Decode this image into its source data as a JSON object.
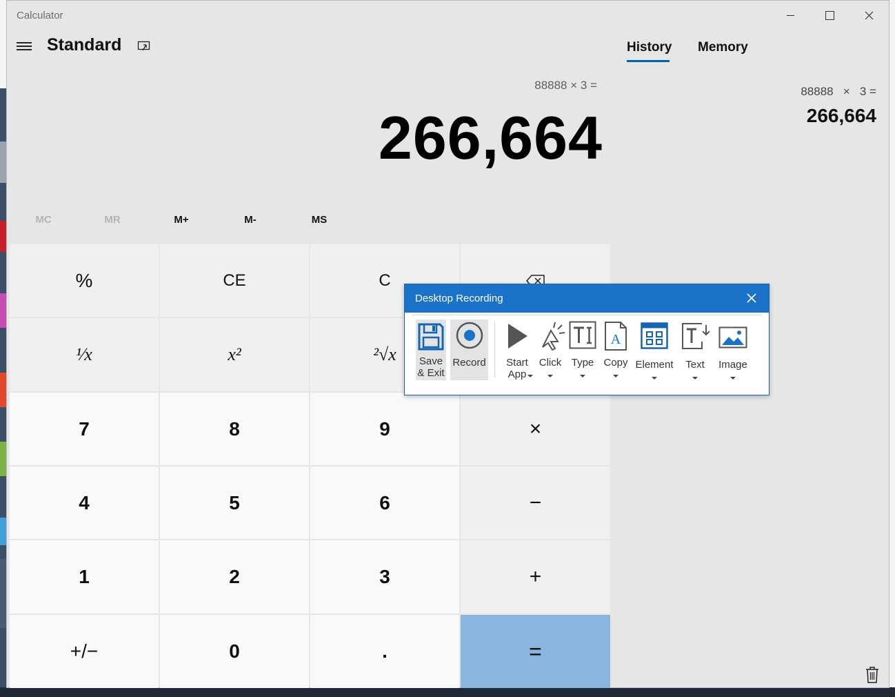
{
  "window": {
    "title": "Calculator",
    "minimize_icon": "minimize-icon",
    "maximize_icon": "maximize-icon",
    "close_icon": "close-icon"
  },
  "header": {
    "menu_icon": "hamburger-icon",
    "mode": "Standard",
    "keep_on_top_icon": "keep-on-top-icon"
  },
  "tabs": [
    {
      "label": "History",
      "selected": true
    },
    {
      "label": "Memory",
      "selected": false
    }
  ],
  "display": {
    "expression": "88888 × 3 =",
    "result": "266,664"
  },
  "history": {
    "entries": [
      {
        "expression": "88888   ×   3 =",
        "result": "266,664"
      }
    ],
    "clear_icon": "trash-icon"
  },
  "memory_buttons": [
    {
      "label": "MC",
      "enabled": false
    },
    {
      "label": "MR",
      "enabled": false
    },
    {
      "label": "M+",
      "enabled": true
    },
    {
      "label": "M-",
      "enabled": true
    },
    {
      "label": "MS",
      "enabled": true
    }
  ],
  "keypad": [
    [
      "%",
      "CE",
      "C",
      "⌫"
    ],
    [
      "¹⁄x",
      "x²",
      "²√x",
      "÷"
    ],
    [
      "7",
      "8",
      "9",
      "×"
    ],
    [
      "4",
      "5",
      "6",
      "−"
    ],
    [
      "1",
      "2",
      "3",
      "+"
    ],
    [
      "+/−",
      "0",
      ".",
      "="
    ]
  ],
  "recorder": {
    "title": "Desktop Recording",
    "tools": [
      {
        "label": "Save & Exit",
        "icon": "floppy-disk-icon"
      },
      {
        "label": "Record",
        "icon": "record-icon"
      },
      {
        "label": "Start App",
        "icon": "play-icon"
      },
      {
        "label": "Click",
        "icon": "cursor-click-icon"
      },
      {
        "label": "Type",
        "icon": "type-text-icon"
      },
      {
        "label": "Copy",
        "icon": "document-copy-icon"
      },
      {
        "label": "Element",
        "icon": "element-grid-icon"
      },
      {
        "label": "Text",
        "icon": "text-extract-icon"
      },
      {
        "label": "Image",
        "icon": "image-icon"
      }
    ]
  },
  "colors": {
    "accent": "#0063b1",
    "equals_key": "#8ab5de",
    "recorder_titlebar": "#1a73c9",
    "recorder_icon": "#1464b4"
  }
}
